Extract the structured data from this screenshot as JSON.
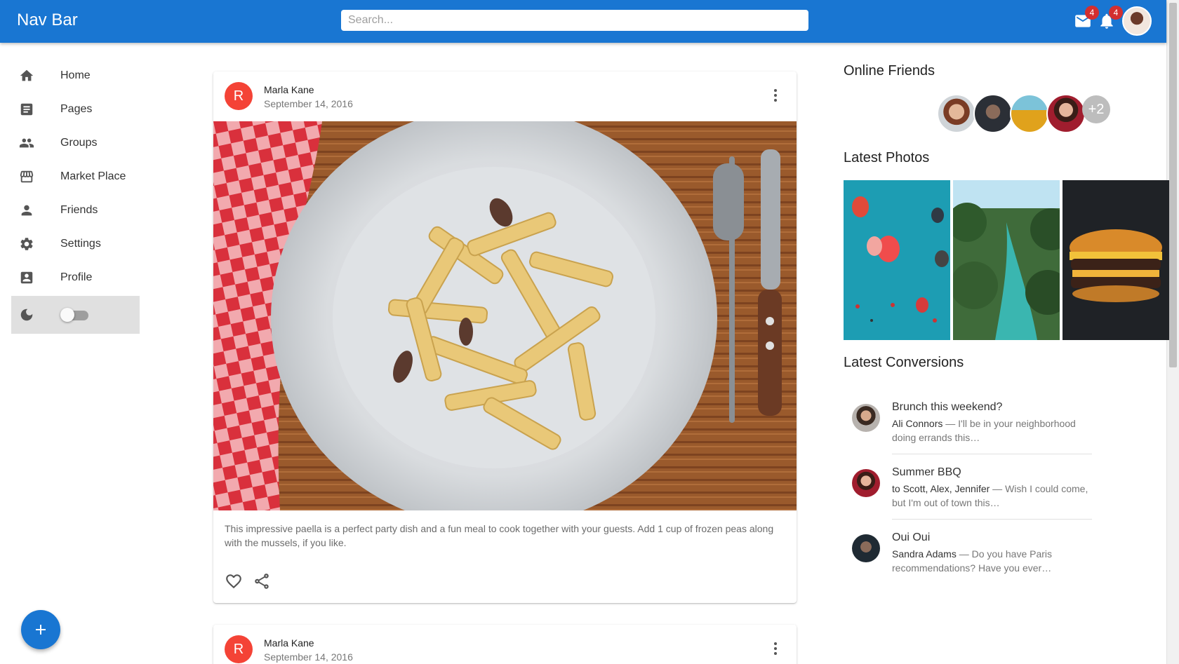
{
  "appbar": {
    "title": "Nav Bar",
    "search_placeholder": "Search...",
    "mail_badge": "4",
    "notifications_badge": "4",
    "color": "#1976d2"
  },
  "sidebar": {
    "items": [
      {
        "label": "Home",
        "icon": "home-icon"
      },
      {
        "label": "Pages",
        "icon": "article-icon"
      },
      {
        "label": "Groups",
        "icon": "groups-icon"
      },
      {
        "label": "Market Place",
        "icon": "storefront-icon"
      },
      {
        "label": "Friends",
        "icon": "person-icon"
      },
      {
        "label": "Settings",
        "icon": "settings-icon"
      },
      {
        "label": "Profile",
        "icon": "account-box-icon"
      }
    ],
    "dark_mode_icon": "moon-icon",
    "dark_mode_enabled": false
  },
  "posts": [
    {
      "avatar_letter": "R",
      "author": "Marla Kane",
      "date": "September 14, 2016",
      "text": "This impressive paella is a perfect party dish and a fun meal to cook together with your guests. Add 1 cup of frozen peas along with the mussels, if you like."
    },
    {
      "avatar_letter": "R",
      "author": "Marla Kane",
      "date": "September 14, 2016"
    }
  ],
  "right": {
    "online_friends_title": "Online Friends",
    "more_friends": "+2",
    "latest_photos_title": "Latest Photos",
    "latest_conversions_title": "Latest Conversions",
    "conversations": [
      {
        "title": "Brunch this weekend?",
        "sender": "Ali Connors",
        "snippet": " — I'll be in your neighborhood doing errands this…"
      },
      {
        "title": "Summer BBQ",
        "sender": "to Scott, Alex, Jennifer",
        "snippet": " — Wish I could come, but I'm out of town this…"
      },
      {
        "title": "Oui Oui",
        "sender": "Sandra Adams",
        "snippet": " — Do you have Paris recommendations? Have you ever…"
      }
    ]
  },
  "fab": {
    "icon": "add-icon"
  }
}
